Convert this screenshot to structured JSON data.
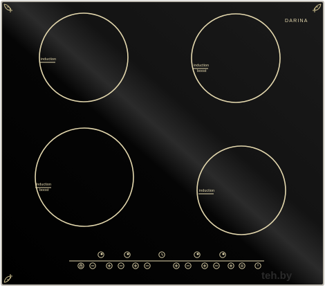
{
  "brand": "DARINA",
  "zones": [
    {
      "id": "top-left",
      "labels": [
        "induction"
      ]
    },
    {
      "id": "top-right",
      "labels": [
        "induction",
        "boost"
      ]
    },
    {
      "id": "bottom-left",
      "labels": [
        "induction",
        "boost"
      ]
    },
    {
      "id": "bottom-right",
      "labels": [
        "induction"
      ]
    }
  ],
  "controls": {
    "upper_row": [
      "zone-indicator-icon",
      "zone-indicator-icon",
      "timer-icon",
      "zone-indicator-icon",
      "zone-indicator-icon"
    ],
    "lower_row": [
      "lock-icon",
      "minus-icon",
      "plus-icon",
      "minus-icon",
      "plus-icon",
      "minus-icon",
      "plus-icon",
      "minus-icon",
      "plus-icon",
      "minus-icon",
      "plus-icon",
      "pause-icon",
      "power-icon"
    ]
  },
  "watermark": {
    "logo_text": "teh.by"
  },
  "colors": {
    "glass": "#0b0b0b",
    "print": "#e4d8ae",
    "frame": "#bdb9b0"
  }
}
